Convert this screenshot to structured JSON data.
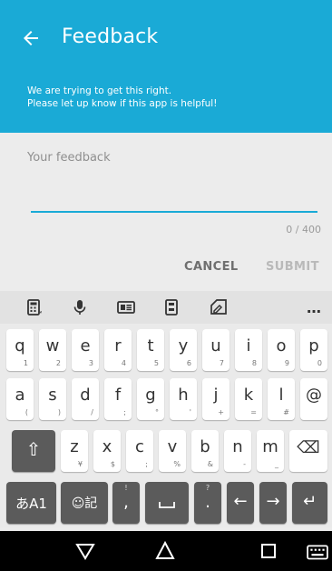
{
  "header": {
    "title": "Feedback",
    "subtitle_line1": "We are trying to get this right.",
    "subtitle_line2": "Please let up know if this app is helpful!"
  },
  "form": {
    "placeholder": "Your feedback",
    "counter": "0 / 400",
    "cancel_label": "CANCEL",
    "submit_label": "SUBMIT"
  },
  "keyboard": {
    "toolbar_icons": [
      "calculator-icon",
      "microphone-icon",
      "keyboard-layout-icon",
      "clipboard-icon",
      "edit-icon",
      "more-icon"
    ],
    "toolbar_more": "…",
    "row1": [
      {
        "main": "q",
        "sub": "1"
      },
      {
        "main": "w",
        "sub": "2"
      },
      {
        "main": "e",
        "sub": "3"
      },
      {
        "main": "r",
        "sub": "4"
      },
      {
        "main": "t",
        "sub": "5"
      },
      {
        "main": "y",
        "sub": "6"
      },
      {
        "main": "u",
        "sub": "7"
      },
      {
        "main": "i",
        "sub": "8"
      },
      {
        "main": "o",
        "sub": "9"
      },
      {
        "main": "p",
        "sub": "0"
      }
    ],
    "row2": [
      {
        "main": "a",
        "sub": "("
      },
      {
        "main": "s",
        "sub": ")"
      },
      {
        "main": "d",
        "sub": "/"
      },
      {
        "main": "f",
        "sub": ";"
      },
      {
        "main": "g",
        "sub": "°"
      },
      {
        "main": "h",
        "sub": "'"
      },
      {
        "main": "j",
        "sub": "+"
      },
      {
        "main": "k",
        "sub": "="
      },
      {
        "main": "l",
        "sub": "#"
      },
      {
        "main": "@",
        "sub": ""
      }
    ],
    "row3": [
      {
        "main": "z",
        "sub": "¥"
      },
      {
        "main": "x",
        "sub": "$"
      },
      {
        "main": "c",
        "sub": ";"
      },
      {
        "main": "v",
        "sub": "%"
      },
      {
        "main": "b",
        "sub": "&"
      },
      {
        "main": "n",
        "sub": "-"
      },
      {
        "main": "m",
        "sub": "_"
      }
    ],
    "lang_key": "あA1",
    "emoji_key": "☺記",
    "comma_key": ",",
    "comma_sup": "!",
    "period_key": ".",
    "period_sup": "?",
    "shift_symbol": "⇧",
    "backspace_symbol": "⌫",
    "left_symbol": "←",
    "right_symbol": "→",
    "enter_symbol": "↵"
  },
  "colors": {
    "accent": "#1aaad6",
    "key_dark": "#5b5b5b"
  }
}
